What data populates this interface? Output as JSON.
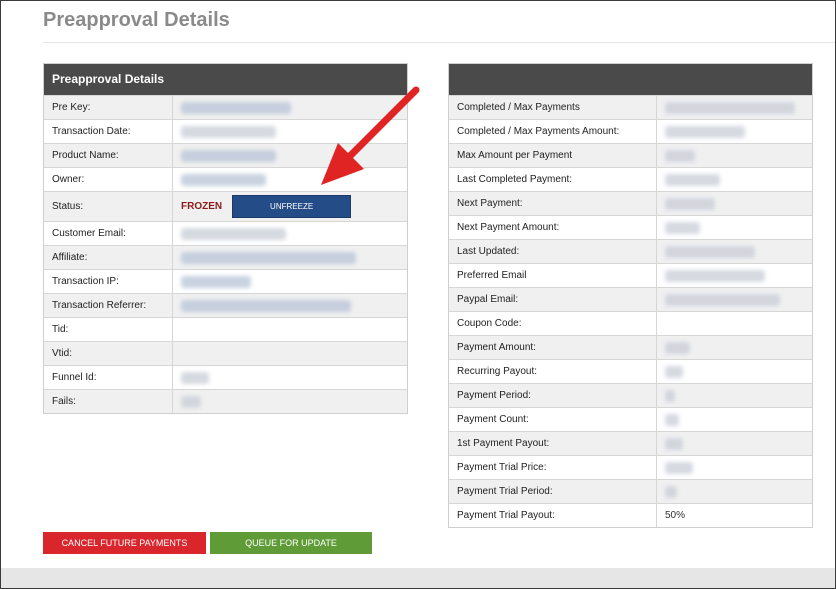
{
  "page": {
    "title": "Preapproval Details"
  },
  "left_panel": {
    "header": "Preapproval Details",
    "rows": [
      {
        "label": "Pre Key:",
        "blur_width": 110,
        "blur_color": "blue"
      },
      {
        "label": "Transaction Date:",
        "blur_width": 95,
        "blur_color": "gray"
      },
      {
        "label": "Product Name:",
        "blur_width": 95,
        "blur_color": "blue"
      },
      {
        "label": "Owner:",
        "blur_width": 85,
        "blur_color": "blue"
      },
      {
        "label": "Status:"
      },
      {
        "label": "Customer Email:",
        "blur_width": 105,
        "blur_color": "gray"
      },
      {
        "label": "Affiliate:",
        "blur_width": 175,
        "blur_color": "blue"
      },
      {
        "label": "Transaction IP:",
        "blur_width": 70,
        "blur_color": "blue"
      },
      {
        "label": "Transaction Referrer:",
        "blur_width": 170,
        "blur_color": "blue"
      },
      {
        "label": "Tid:",
        "blur_width": 0
      },
      {
        "label": "Vtid:",
        "blur_width": 0
      },
      {
        "label": "Funnel Id:",
        "blur_width": 28,
        "blur_color": "gray"
      },
      {
        "label": "Fails:",
        "blur_width": 20,
        "blur_color": "gray"
      }
    ],
    "status": {
      "value": "FROZEN",
      "button_label": "UNFREEZE"
    }
  },
  "right_panel": {
    "header": "",
    "rows": [
      {
        "label": "Completed / Max Payments",
        "blur_width": 130,
        "partial": ""
      },
      {
        "label": "Completed / Max Payments Amount:",
        "blur_width": 80
      },
      {
        "label": "Max Amount per Payment",
        "blur_width": 30
      },
      {
        "label": "Last Completed Payment:",
        "blur_width": 55
      },
      {
        "label": "Next Payment:",
        "blur_width": 50
      },
      {
        "label": "Next Payment Amount:",
        "blur_width": 35
      },
      {
        "label": "Last Updated:",
        "blur_width": 90
      },
      {
        "label": "Preferred Email",
        "blur_width": 100
      },
      {
        "label": "Paypal Email:",
        "blur_width": 115
      },
      {
        "label": "Coupon Code:",
        "blur_width": 0
      },
      {
        "label": "Payment Amount:",
        "blur_width": 25
      },
      {
        "label": "Recurring Payout:",
        "blur_width": 18
      },
      {
        "label": "Payment Period:",
        "blur_width": 10
      },
      {
        "label": "Payment Count:",
        "blur_width": 14
      },
      {
        "label": "1st Payment Payout:",
        "blur_width": 18
      },
      {
        "label": "Payment Trial Price:",
        "blur_width": 28
      },
      {
        "label": "Payment Trial Period:",
        "blur_width": 12
      },
      {
        "label": "Payment Trial Payout:",
        "blur_width": 0,
        "partial": "50%"
      }
    ]
  },
  "actions": {
    "cancel_label": "CANCEL FUTURE PAYMENTS",
    "queue_label": "QUEUE FOR UPDATE"
  },
  "colors": {
    "header_bg": "#4a4a4a",
    "frozen": "#8b1a1a",
    "unfreeze_bg": "#244c86",
    "cancel_bg": "#d9262d",
    "queue_bg": "#5f9b36",
    "arrow": "#e02424"
  }
}
